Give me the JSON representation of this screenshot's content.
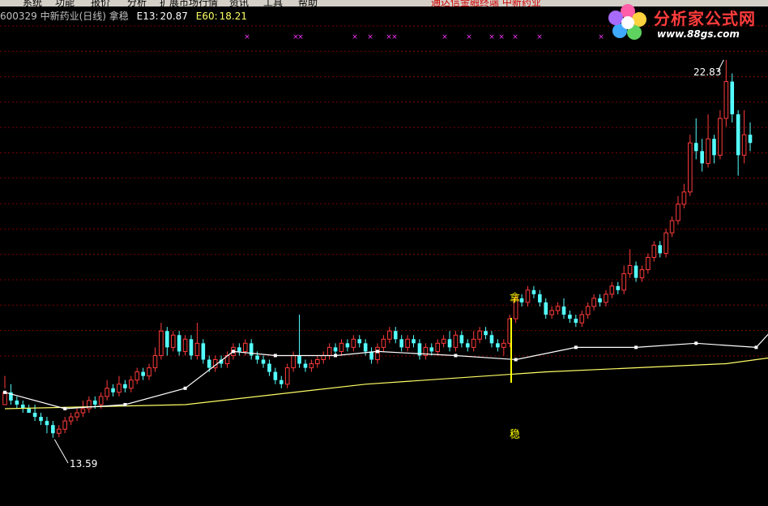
{
  "menu": {
    "items": [
      "系统",
      "功能",
      "报价",
      "分析",
      "扩展市场行情",
      "资讯",
      "工具",
      "帮助"
    ],
    "notice": "通达信金融终端 中新药业"
  },
  "header": {
    "stock": "600329 中新药业(日线) 拿稳",
    "e13_label": "E13:",
    "e13_value": "20.87",
    "e60_label": "E60:",
    "e60_value": "18.21"
  },
  "logo": {
    "name": "分析家公式网",
    "url": "www.88gs.com"
  },
  "colors": {
    "up": "#ff3b3b",
    "down": "#54ffff",
    "e13": "#ffffff",
    "e60": "#ffff66",
    "grid": "#7a0000",
    "marker": "#ff33ff",
    "signal": "#ffff00"
  },
  "annotations": {
    "high": "22.83",
    "low": "13.59",
    "signal_top": "拿",
    "signal_bottom": "稳"
  },
  "chart_data": {
    "type": "candlestick",
    "title": "600329 中新药业(日线) 拿稳",
    "x": "trading days (daily)",
    "ylim": [
      12.0,
      23.7
    ],
    "highlight_high": 22.83,
    "highlight_low": 13.59,
    "e13_last": 20.87,
    "e60_last": 18.21,
    "e13_key_points": [
      [
        0,
        14.7
      ],
      [
        10,
        14.3
      ],
      [
        20,
        14.4
      ],
      [
        30,
        14.8
      ],
      [
        38,
        15.7
      ],
      [
        45,
        15.6
      ],
      [
        55,
        15.6
      ],
      [
        62,
        15.7
      ],
      [
        75,
        15.6
      ],
      [
        85,
        15.5
      ],
      [
        95,
        15.8
      ],
      [
        105,
        15.8
      ],
      [
        115,
        15.9
      ],
      [
        125,
        15.8
      ],
      [
        130,
        16.6
      ],
      [
        140,
        16.5
      ],
      [
        145,
        16.2
      ],
      [
        155,
        16.3
      ],
      [
        165,
        17.2
      ],
      [
        175,
        18.0
      ],
      [
        180,
        19.3
      ],
      [
        187,
        20.8
      ],
      [
        190,
        20.87
      ]
    ],
    "e60_key_points": [
      [
        0,
        14.3
      ],
      [
        30,
        14.4
      ],
      [
        60,
        14.9
      ],
      [
        90,
        15.2
      ],
      [
        120,
        15.4
      ],
      [
        135,
        15.7
      ],
      [
        150,
        16.0
      ],
      [
        165,
        16.6
      ],
      [
        175,
        17.2
      ],
      [
        190,
        18.21
      ]
    ],
    "candles_ohlc": [
      [
        14.4,
        14.7,
        15.1,
        14.8
      ],
      [
        14.7,
        14.5,
        14.9,
        14.4
      ],
      [
        14.5,
        14.4,
        14.6,
        14.3
      ],
      [
        14.4,
        14.3,
        14.5,
        14.2
      ],
      [
        14.3,
        14.2,
        14.4,
        14.2
      ],
      [
        14.2,
        14.1,
        14.4,
        14.0
      ],
      [
        14.1,
        14.0,
        14.2,
        13.9
      ],
      [
        14.0,
        13.9,
        14.1,
        13.7
      ],
      [
        13.9,
        13.7,
        14.0,
        13.59
      ],
      [
        13.7,
        13.8,
        13.9,
        13.6
      ],
      [
        13.8,
        14.0,
        14.1,
        13.7
      ],
      [
        14.0,
        14.1,
        14.2,
        13.9
      ],
      [
        14.1,
        14.2,
        14.3,
        14.0
      ],
      [
        14.2,
        14.3,
        14.5,
        14.1
      ],
      [
        14.3,
        14.5,
        14.6,
        14.2
      ],
      [
        14.5,
        14.4,
        14.6,
        14.3
      ],
      [
        14.4,
        14.6,
        14.7,
        14.3
      ],
      [
        14.6,
        14.8,
        15.0,
        14.5
      ],
      [
        14.8,
        14.7,
        14.9,
        14.6
      ],
      [
        14.7,
        14.9,
        15.1,
        14.6
      ],
      [
        14.9,
        14.8,
        15.0,
        14.7
      ],
      [
        14.8,
        15.0,
        15.1,
        14.7
      ],
      [
        15.0,
        15.2,
        15.3,
        14.9
      ],
      [
        15.2,
        15.1,
        15.3,
        15.0
      ],
      [
        15.1,
        15.3,
        15.4,
        15.0
      ],
      [
        15.3,
        15.6,
        15.8,
        15.2
      ],
      [
        15.6,
        16.2,
        16.4,
        15.5
      ],
      [
        16.2,
        15.8,
        16.3,
        15.6
      ],
      [
        15.8,
        16.1,
        16.2,
        15.7
      ],
      [
        16.1,
        15.7,
        16.2,
        15.6
      ],
      [
        15.7,
        16.0,
        16.1,
        15.6
      ],
      [
        16.0,
        15.6,
        16.1,
        15.5
      ],
      [
        15.6,
        15.9,
        16.4,
        15.5
      ],
      [
        15.9,
        15.5,
        16.0,
        15.4
      ],
      [
        15.5,
        15.3,
        15.6,
        15.2
      ],
      [
        15.3,
        15.5,
        15.6,
        15.2
      ],
      [
        15.5,
        15.4,
        15.6,
        15.3
      ],
      [
        15.4,
        15.6,
        15.7,
        15.3
      ],
      [
        15.6,
        15.8,
        15.9,
        15.5
      ],
      [
        15.8,
        15.7,
        15.9,
        15.6
      ],
      [
        15.7,
        15.9,
        16.0,
        15.6
      ],
      [
        15.9,
        15.6,
        16.0,
        15.5
      ],
      [
        15.6,
        15.5,
        15.7,
        15.4
      ],
      [
        15.5,
        15.4,
        15.6,
        15.3
      ],
      [
        15.4,
        15.2,
        15.5,
        15.1
      ],
      [
        15.2,
        15.0,
        15.3,
        14.9
      ],
      [
        15.0,
        14.9,
        15.1,
        14.8
      ],
      [
        14.9,
        15.3,
        15.4,
        14.8
      ],
      [
        15.3,
        15.6,
        15.7,
        15.2
      ],
      [
        15.6,
        15.4,
        16.6,
        15.3
      ],
      [
        15.4,
        15.3,
        15.5,
        15.2
      ],
      [
        15.3,
        15.4,
        15.5,
        15.2
      ],
      [
        15.4,
        15.5,
        15.6,
        15.3
      ],
      [
        15.5,
        15.6,
        15.7,
        15.4
      ],
      [
        15.6,
        15.8,
        15.9,
        15.5
      ],
      [
        15.8,
        15.7,
        15.9,
        15.6
      ],
      [
        15.7,
        15.9,
        16.0,
        15.6
      ],
      [
        15.9,
        15.8,
        16.0,
        15.7
      ],
      [
        15.8,
        16.0,
        16.1,
        15.7
      ],
      [
        16.0,
        15.9,
        16.1,
        15.8
      ],
      [
        15.9,
        15.7,
        16.0,
        15.6
      ],
      [
        15.7,
        15.5,
        15.8,
        15.4
      ],
      [
        15.5,
        15.8,
        15.9,
        15.4
      ],
      [
        15.8,
        16.0,
        16.1,
        15.7
      ],
      [
        16.0,
        16.2,
        16.3,
        15.9
      ],
      [
        16.2,
        16.0,
        16.3,
        15.9
      ],
      [
        16.0,
        15.8,
        16.1,
        15.7
      ],
      [
        15.8,
        16.0,
        16.1,
        15.7
      ],
      [
        16.0,
        15.9,
        16.1,
        15.8
      ],
      [
        15.9,
        15.6,
        16.0,
        15.5
      ],
      [
        15.6,
        15.8,
        15.9,
        15.5
      ],
      [
        15.8,
        15.7,
        15.9,
        15.6
      ],
      [
        15.7,
        15.9,
        16.0,
        15.6
      ],
      [
        15.9,
        16.0,
        16.1,
        15.8
      ],
      [
        16.0,
        15.8,
        16.2,
        15.7
      ],
      [
        15.8,
        16.1,
        16.2,
        15.7
      ],
      [
        16.1,
        15.9,
        16.2,
        15.8
      ],
      [
        15.9,
        15.8,
        16.0,
        15.7
      ],
      [
        15.8,
        16.0,
        16.2,
        15.7
      ],
      [
        16.0,
        16.2,
        16.3,
        15.9
      ],
      [
        16.2,
        16.1,
        16.3,
        16.0
      ],
      [
        16.1,
        15.9,
        16.2,
        15.8
      ],
      [
        15.9,
        15.8,
        16.0,
        15.7
      ],
      [
        15.8,
        15.9,
        16.0,
        15.6
      ],
      [
        15.9,
        16.5,
        16.6,
        15.8
      ],
      [
        16.5,
        17.0,
        17.1,
        16.4
      ],
      [
        17.0,
        16.9,
        17.1,
        16.8
      ],
      [
        16.9,
        17.2,
        17.3,
        16.8
      ],
      [
        17.2,
        17.1,
        17.3,
        17.0
      ],
      [
        17.1,
        16.9,
        17.2,
        16.8
      ],
      [
        16.9,
        16.6,
        17.0,
        16.5
      ],
      [
        16.6,
        16.7,
        16.8,
        16.5
      ],
      [
        16.7,
        16.8,
        16.9,
        16.6
      ],
      [
        16.8,
        16.6,
        17.0,
        16.5
      ],
      [
        16.6,
        16.5,
        16.7,
        16.4
      ],
      [
        16.5,
        16.4,
        16.6,
        16.3
      ],
      [
        16.4,
        16.6,
        16.7,
        16.3
      ],
      [
        16.6,
        16.8,
        16.9,
        16.5
      ],
      [
        16.8,
        17.0,
        17.1,
        16.7
      ],
      [
        17.0,
        16.9,
        17.1,
        16.8
      ],
      [
        16.9,
        17.1,
        17.2,
        16.8
      ],
      [
        17.1,
        17.3,
        17.4,
        17.0
      ],
      [
        17.3,
        17.2,
        17.4,
        17.1
      ],
      [
        17.2,
        17.6,
        17.8,
        17.1
      ],
      [
        17.6,
        17.8,
        18.2,
        17.5
      ],
      [
        17.8,
        17.5,
        17.9,
        17.4
      ],
      [
        17.5,
        17.7,
        17.8,
        17.4
      ],
      [
        17.7,
        18.0,
        18.1,
        17.6
      ],
      [
        18.0,
        18.3,
        18.4,
        17.9
      ],
      [
        18.3,
        18.1,
        18.4,
        18.0
      ],
      [
        18.1,
        18.6,
        18.7,
        18.0
      ],
      [
        18.6,
        18.9,
        19.0,
        18.5
      ],
      [
        18.9,
        19.3,
        19.5,
        18.8
      ],
      [
        19.3,
        19.6,
        19.8,
        19.2
      ],
      [
        19.6,
        20.8,
        21.0,
        19.5
      ],
      [
        20.8,
        20.6,
        21.4,
        20.4
      ],
      [
        20.6,
        20.3,
        20.9,
        20.1
      ],
      [
        20.3,
        20.9,
        21.5,
        20.2
      ],
      [
        20.9,
        20.5,
        21.0,
        20.3
      ],
      [
        20.5,
        21.4,
        21.6,
        20.4
      ],
      [
        21.4,
        22.3,
        22.83,
        21.2
      ],
      [
        22.3,
        21.5,
        22.5,
        21.3
      ],
      [
        21.5,
        20.5,
        21.6,
        20.0
      ],
      [
        20.5,
        21.0,
        21.6,
        20.3
      ],
      [
        21.0,
        20.8,
        21.3,
        20.6
      ]
    ]
  }
}
